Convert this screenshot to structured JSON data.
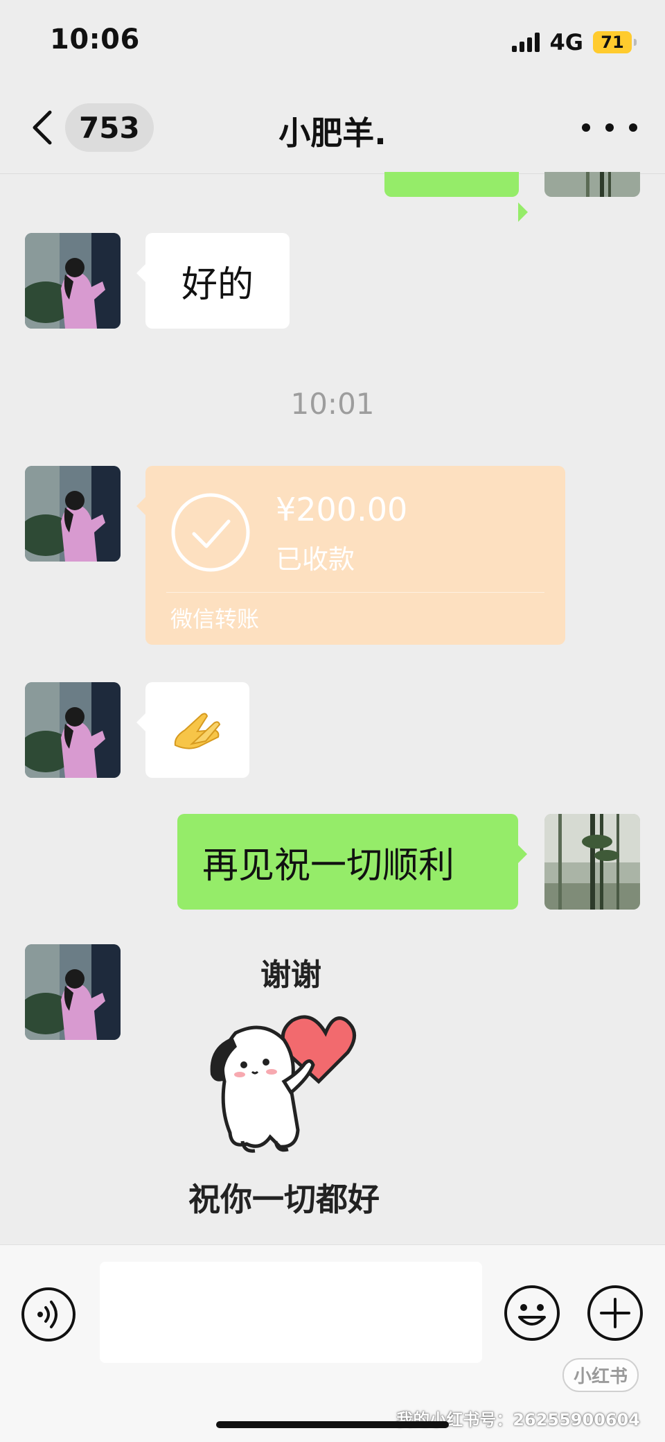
{
  "status_bar": {
    "time": "10:06",
    "network": "4G",
    "battery": "71"
  },
  "nav": {
    "unread_count": "753",
    "title": "小肥羊."
  },
  "messages": [
    {
      "direction": "out",
      "type": "partial",
      "text": ""
    },
    {
      "direction": "in",
      "type": "text",
      "text": "好的"
    },
    {
      "type": "timestamp",
      "text": "10:01"
    },
    {
      "direction": "in",
      "type": "transfer",
      "amount": "¥200.00",
      "status": "已收款",
      "footer": "微信转账"
    },
    {
      "direction": "in",
      "type": "emoji",
      "emoji": "🙏"
    },
    {
      "direction": "out",
      "type": "text",
      "text": "再见祝一切顺利"
    },
    {
      "direction": "in",
      "type": "sticker",
      "top_text": "谢谢",
      "bottom_text": "祝你一切都好"
    }
  ],
  "input": {
    "placeholder": ""
  },
  "watermark": {
    "badge": "小红书",
    "id_text": "我的小红书号：26255900604"
  },
  "colors": {
    "background": "#ededed",
    "incoming_bubble": "#ffffff",
    "outgoing_bubble": "#95ec69",
    "transfer_card": "#fde0c0",
    "battery": "#ffcb2e"
  },
  "icons": {
    "back": "chevron-left-icon",
    "more": "more-horizontal-icon",
    "voice": "voice-icon",
    "emoji": "smiley-icon",
    "plus": "plus-circle-icon",
    "transfer": "check-circle-icon"
  }
}
